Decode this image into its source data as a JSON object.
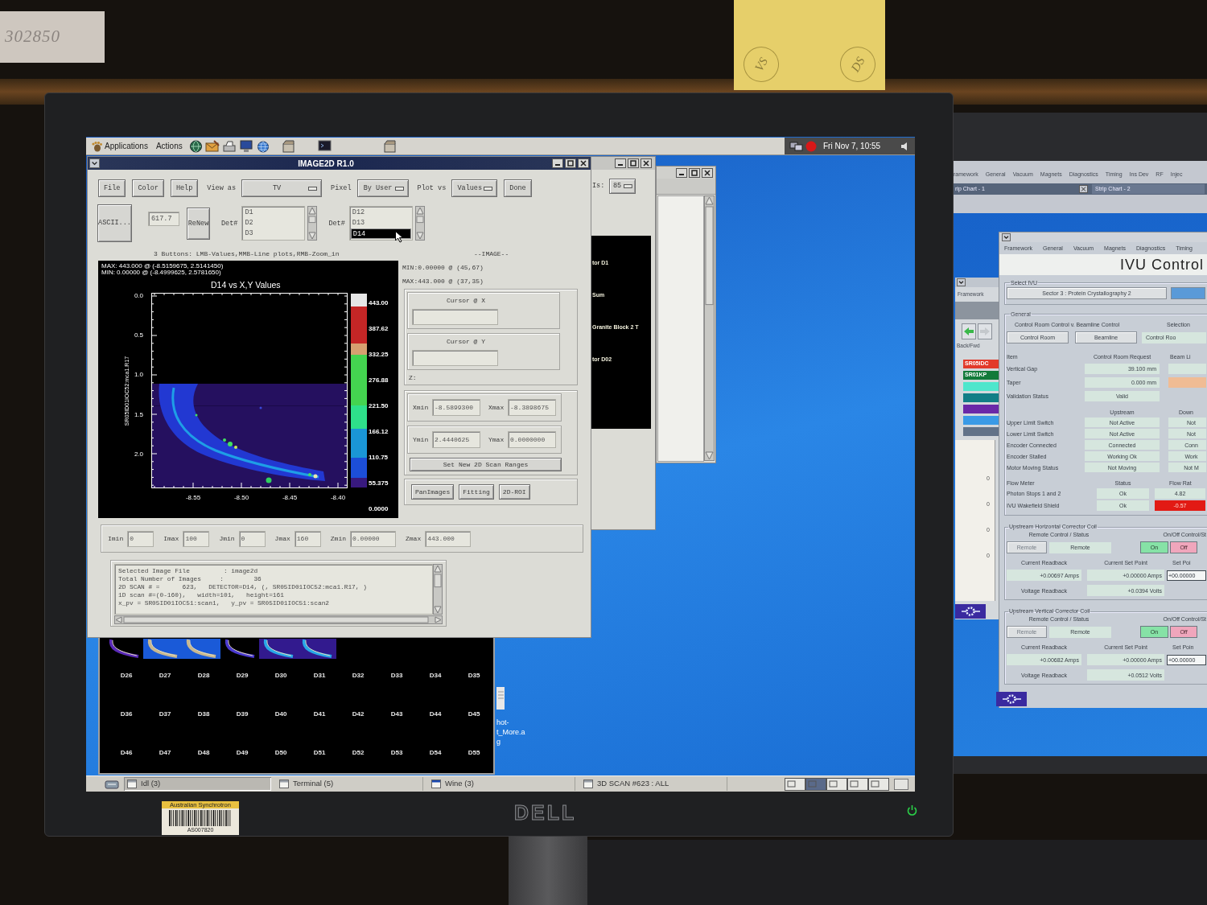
{
  "paper_note": {
    "text": "302850"
  },
  "sticky_note": {
    "marks": [
      "VS",
      "DS"
    ]
  },
  "left_monitor": {
    "brand": "DELL",
    "asset_tag": {
      "owner": "Australian Synchrotron",
      "number": "AS007820"
    }
  },
  "top_panel": {
    "menus": [
      "Applications",
      "Actions"
    ],
    "clock": "Fri Nov 7, 10:55"
  },
  "image2d_window": {
    "title": "IMAGE2D R1.0",
    "toolbar": [
      {
        "kind": "button",
        "label": "File"
      },
      {
        "kind": "button",
        "label": "Color"
      },
      {
        "kind": "button",
        "label": "Help"
      },
      {
        "kind": "dropdown",
        "label": "View as",
        "value": "TV"
      },
      {
        "kind": "dropdown",
        "label": "Pixel",
        "value": "By User"
      },
      {
        "kind": "dropdown",
        "label": "Plot vs",
        "value": "Values"
      },
      {
        "kind": "button",
        "label": "Done"
      }
    ],
    "ascii_button": "ASCII...",
    "value_field": "617.7",
    "renew_button": "ReNew",
    "detector_lists": [
      {
        "label": "Det#",
        "items": [
          {
            "text": "D1",
            "selected": false
          },
          {
            "text": "D2",
            "selected": false
          },
          {
            "text": "D3",
            "selected": false
          }
        ]
      },
      {
        "label": "Det#",
        "items": [
          {
            "text": "D12",
            "selected": false
          },
          {
            "text": "D13",
            "selected": false
          },
          {
            "text": "D14",
            "selected": true
          }
        ]
      }
    ],
    "hint": "3 Buttons: LMB-Values,MMB-Line plots,RMB-Zoom_in",
    "plot": {
      "max_line": "MAX: 443.000 @ (-8.5159675, 2.5141450)",
      "min_line": "MIN: 0.00000 @ (-8.4999625, 2.5781650)",
      "title": "D14 vs X,Y Values",
      "ylabel": "SR05ID01IOC52:mca1.R17",
      "yticks": [
        "0.0",
        "0.5",
        "1.0",
        "1.5",
        "2.0"
      ],
      "xticks": [
        "-8.55",
        "-8.50",
        "-8.45",
        "-8.40"
      ],
      "colorbar_labels": [
        "443.00",
        "387.62",
        "332.25",
        "276.88",
        "221.50",
        "166.12",
        "110.75",
        "55.375",
        "0.0000"
      ]
    },
    "image_panel": {
      "heading": "--IMAGE--",
      "min_line": "MIN:0.00000 @ (45,67)",
      "max_line": "MAX:443.000 @ (37,35)",
      "cursors": [
        {
          "label": "Cursor @ X"
        },
        {
          "label": "Cursor @ Y"
        }
      ],
      "z_label": "Z:",
      "ranges": [
        {
          "label": "Xmin",
          "value": "-8.5899300"
        },
        {
          "label": "Xmax",
          "value": "-8.3898675"
        },
        {
          "label": "Ymin",
          "value": "2.4440625"
        },
        {
          "label": "Ymax",
          "value": "0.0000000"
        }
      ],
      "set_ranges_button": "Set New 2D Scan Ranges",
      "buttons": [
        "PanImages",
        "Fitting",
        "2D-ROI"
      ]
    },
    "index_fields": [
      {
        "label": "Imin",
        "value": "0"
      },
      {
        "label": "Imax",
        "value": "100"
      },
      {
        "label": "Jmin",
        "value": "0"
      },
      {
        "label": "Jmax",
        "value": "160"
      },
      {
        "label": "Zmin",
        "value": "0.00000"
      },
      {
        "label": "Zmax",
        "value": "443.000"
      }
    ],
    "info_lines": [
      "Selected Image File         : image2d",
      "Total Number of Images     :        36",
      "2D SCAN # =      623,   DETECTOR=D14, (, SR05ID01IOC52:mca1.R17, )",
      "1D scan #=(0-160),   width=101,   height=161",
      "x_pv = SR05ID01IOC51:scan1,   y_pv = SR05ID01IOC51:scan2"
    ]
  },
  "roi_window": {
    "dropdown_label": "Is:",
    "dropdown_value": "85",
    "labels": [
      "tor D1",
      "Sum",
      "Granite Block 2 T",
      "tor D02"
    ]
  },
  "thumbnail_window": {
    "labels": [
      "D26",
      "D27",
      "D28",
      "D29",
      "D30",
      "D31",
      "D32",
      "D33",
      "D34",
      "D35",
      "D36",
      "D37",
      "D38",
      "D39",
      "D40",
      "D41",
      "D42",
      "D43",
      "D44",
      "D45",
      "D46",
      "D47",
      "D48",
      "D49",
      "D50",
      "D51",
      "D52",
      "D53",
      "D54",
      "D55"
    ]
  },
  "desktop_icon": {
    "label_lines": [
      "hot-",
      "t_More.a",
      "g"
    ]
  },
  "taskbar": {
    "items": [
      {
        "label": "Idl (3)",
        "selected": true
      },
      {
        "label": "Terminal (5)",
        "selected": false
      },
      {
        "label": "Wine (3)",
        "selected": false
      },
      {
        "label": "3D SCAN #623 : ALL",
        "selected": false
      }
    ]
  },
  "right_monitor": {
    "menu": [
      "ramework",
      "General",
      "Vacuum",
      "Magnets",
      "Diagnostics",
      "Timing",
      "Ins Dev",
      "RF",
      "Injec"
    ],
    "strip_tabs": [
      "rip Chart - 1",
      "Strip Chart - 2"
    ],
    "side_window": {
      "menu": "Framework",
      "nav_label": "Back/Fwd",
      "tags": [
        {
          "text": "SR05IDC",
          "color": "#e2392a"
        },
        {
          "text": "SR01KP",
          "color": "#127a3a"
        },
        {
          "color": "#4ee6cc"
        },
        {
          "color": "#127e86"
        },
        {
          "color": "#6a28a8"
        },
        {
          "color": "#3a9ae6"
        },
        {
          "color": "#627288"
        }
      ],
      "values": [
        "0",
        "0",
        "0",
        "0"
      ]
    },
    "ivu_window": {
      "menu": [
        "Framework",
        "General",
        "Vacuum",
        "Magnets",
        "Diagnostics",
        "Timing"
      ],
      "title": "IVU Control",
      "select_group": {
        "legend": "Select IVU",
        "button": "Sector 3 : Protein Crystallography 2"
      },
      "general_group": {
        "legend": "General",
        "mode_label": "Control Room Control v. Beamline Control",
        "selection_label": "Selection",
        "mode_buttons": [
          "Control Room",
          "Beamline"
        ],
        "selection_value": "Control Roo",
        "request_header": [
          "Item",
          "Control Room Request",
          "Beam Li"
        ],
        "request_rows": [
          {
            "label": "Vertical Gap",
            "request": "39.100 mm",
            "beamline_field": {
              "color": "#d6e6de"
            }
          },
          {
            "label": "Taper",
            "request": "0.000 mm",
            "beamline_field": {
              "color": "#f0bc94"
            }
          },
          {
            "label": "Validation Status",
            "request": "Valid"
          }
        ],
        "limit_header": [
          "Upstream",
          "Down"
        ],
        "limit_rows": [
          {
            "label": "Upper Limit Switch",
            "upstream": "Not Active",
            "downstream": "Not"
          },
          {
            "label": "Lower Limit Switch",
            "upstream": "Not Active",
            "downstream": "Not"
          },
          {
            "label": "Encoder Connected",
            "upstream": "Connected",
            "downstream": "Conn"
          },
          {
            "label": "Encoder Stalled",
            "upstream": "Working Ok",
            "downstream": "Work"
          },
          {
            "label": "Motor Moving Status",
            "upstream": "Not Moving",
            "downstream": "Not M"
          }
        ],
        "flow_header": [
          "Flow Meter",
          "Status",
          "Flow Rat"
        ],
        "flow_rows": [
          {
            "label": "Photon Stops 1 and 2",
            "status": "Ok",
            "rate": "4.82",
            "alarm": false
          },
          {
            "label": "IVU Wakefield Shield",
            "status": "Ok",
            "rate": "-0.57",
            "alarm": true
          }
        ]
      },
      "coils": [
        {
          "legend": "Upstream Horizontal Corrector Coil",
          "remote_label": "Remote Control / Status",
          "remote_button": {
            "label": "Remote",
            "disabled": true
          },
          "remote_status": "Remote",
          "onoff_label": "On/Off Control/St",
          "on_button": "On",
          "off_button": "Off",
          "readback_label": "Current Readback",
          "readback": "+0.00697 Amps",
          "setpoint_label": "Current Set Point",
          "setpoint": "+0.00000 Amps",
          "setpoint_input_label": "Set Poi",
          "setpoint_input": "+00.00000",
          "voltage_label": "Voltage Readback",
          "voltage": "+0.0394 Volts"
        },
        {
          "legend": "Upstream Vertical Corrector Coil",
          "remote_label": "Remote Control / Status",
          "remote_button": {
            "label": "Remote",
            "disabled": true
          },
          "remote_status": "Remote",
          "onoff_label": "On/Off Control/St",
          "on_button": "On",
          "off_button": "Off",
          "readback_label": "Current Readback",
          "readback": "+0.00682 Amps",
          "setpoint_label": "Current Set Point",
          "setpoint": "+0.00000 Amps",
          "setpoint_input_label": "Set Poin",
          "setpoint_input": "+00.00000",
          "voltage_label": "Voltage Readback",
          "voltage": "+0.0512 Volts"
        }
      ]
    }
  }
}
